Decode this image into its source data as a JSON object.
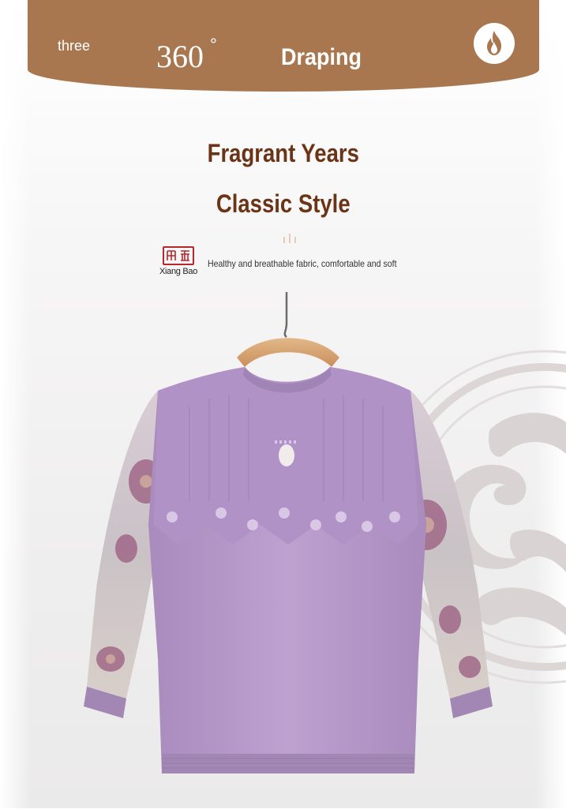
{
  "banner": {
    "left_text": "three",
    "degree_number": "360",
    "degree_symbol": "°",
    "title": "Draping",
    "badge_icon": "flame-icon",
    "color": "#a8774f"
  },
  "headline": {
    "line1": "Fragrant Years",
    "line2": "Classic Style",
    "color": "#6b3416"
  },
  "brand": {
    "logo": "seal-logo",
    "name": "Xiang Bao",
    "tagline": "Healthy and breathable fabric, comfortable and soft"
  },
  "product": {
    "image": "lavender knit top with floral print sleeves on wooden hanger",
    "color": "#b89ac8"
  }
}
